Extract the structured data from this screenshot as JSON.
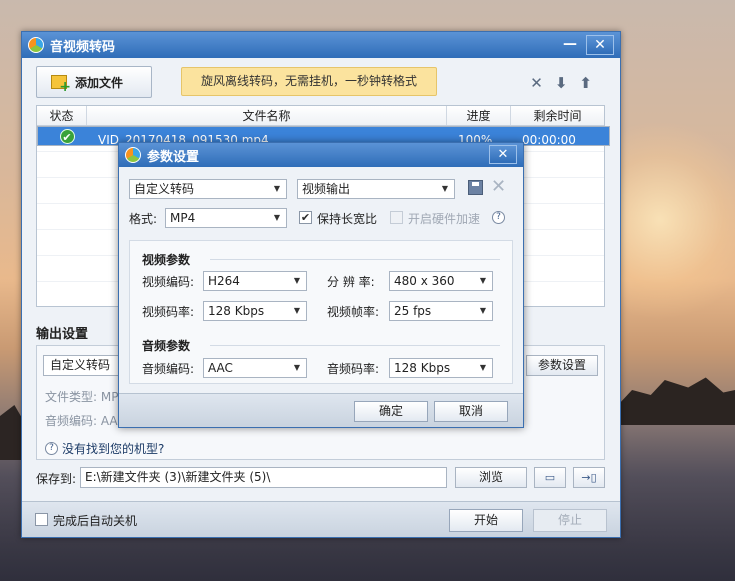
{
  "main": {
    "title": "音视频转码",
    "minimize": "—",
    "close": "✕",
    "add_file": "添加文件",
    "slogan": "旋风离线转码，无需挂机，一秒钟转格式",
    "icons": {
      "remove": "✕",
      "down": "⬇",
      "up": "⬆"
    },
    "table": {
      "headers": [
        "状态",
        "文件名称",
        "进度",
        "剩余时间"
      ],
      "row": {
        "name": "VID_20170418_091530.mp4",
        "progress": "100%",
        "remaining": "00:00:00",
        "status_icon": "check-icon"
      }
    },
    "output": {
      "label": "输出设置",
      "preset": "自定义转码",
      "param_button": "参数设置",
      "file_type_label": "文件类型:",
      "file_type_value": "MP",
      "audio_codec_label": "音频编码:",
      "audio_codec_value": "AA",
      "help": "没有找到您的机型?"
    },
    "save": {
      "label": "保存到:",
      "path": "E:\\新建文件夹 (3)\\新建文件夹 (5)\\",
      "browse": "浏览"
    },
    "bottom": {
      "auto_shutdown": "完成后自动关机",
      "start": "开始",
      "stop": "停止"
    }
  },
  "dialog": {
    "title": "参数设置",
    "close": "✕",
    "preset": "自定义转码",
    "output_type": "视频输出",
    "format_label": "格式:",
    "format": "MP4",
    "keep_ratio": "保持长宽比",
    "hw_accel": "开启硬件加速",
    "video": {
      "title": "视频参数",
      "codec_label": "视频编码:",
      "codec": "H264",
      "resolution_label": "分 辨 率:",
      "resolution": "480 x 360",
      "bitrate_label": "视频码率:",
      "bitrate": "128 Kbps",
      "fps_label": "视频帧率:",
      "fps": "25 fps"
    },
    "audio": {
      "title": "音频参数",
      "codec_label": "音频编码:",
      "codec": "AAC",
      "bitrate_label": "音频码率:",
      "bitrate": "128 Kbps"
    },
    "ok": "确定",
    "cancel": "取消"
  }
}
